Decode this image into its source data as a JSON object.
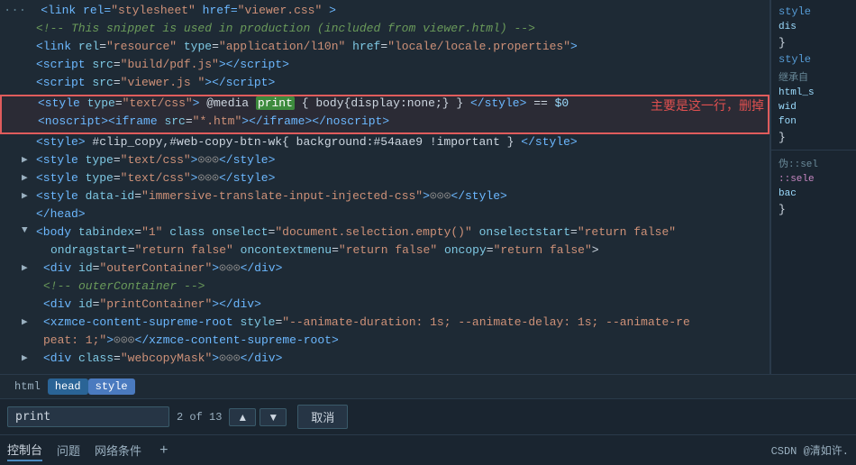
{
  "editor": {
    "lines": [
      {
        "id": "line1",
        "gutter": "",
        "expand": "",
        "content_html": "&lt;link rel=\"stylesheet\" href=\"viewer.css\" &gt;"
      },
      {
        "id": "line2",
        "gutter": "",
        "expand": "",
        "content_html": "&lt;!-- This snippet is used in production (included from viewer.html) --&gt;"
      },
      {
        "id": "line3",
        "gutter": "",
        "expand": "",
        "content_html": "&lt;link rel=\"resource\" type=\"application/l10n\" href=\"locale/locale.properties\"&gt;"
      },
      {
        "id": "line4",
        "gutter": "",
        "expand": "",
        "content_html": "&lt;script src=\"build/pdf.js\"&gt;&lt;/script&gt;"
      },
      {
        "id": "line5",
        "gutter": "",
        "expand": "",
        "content_html": "&lt;script src=\"viewer.js \"&gt;&lt;/script&gt;"
      }
    ],
    "highlighted_lines": [
      {
        "id": "hl1",
        "content_html": "&lt;style type=\"text/css\"&gt; @media <span class=\"c-green-bg\">print</span> { body{display:none;} } &lt;/style&gt; == $0"
      },
      {
        "id": "hl2",
        "content_html": "&lt;noscript&gt;&lt;iframe src=\"*.htm\"&gt;&lt;/iframe&gt;&lt;/noscript&gt;"
      }
    ],
    "after_lines": [
      {
        "id": "al1",
        "content_html": "&lt;style&gt; #clip_copy,#web-copy-btn-wk{ background:#54aae9 !important } &lt;/style&gt;"
      },
      {
        "id": "al2",
        "expand": "▶",
        "content_html": "&lt;style type=\"text/css\"&gt;<span class=\"c-gray\">⊙⊙⊙</span>&lt;/style&gt;"
      },
      {
        "id": "al3",
        "expand": "▶",
        "content_html": "&lt;style type=\"text/css\"&gt;<span class=\"c-gray\">⊙⊙⊙</span>&lt;/style&gt;"
      },
      {
        "id": "al4",
        "expand": "▶",
        "content_html": "&lt;style data-id=\"immersive-translate-input-injected-css\"&gt;<span class=\"c-gray\">⊙⊙⊙</span>&lt;/style&gt;"
      },
      {
        "id": "al5",
        "content_html": "&lt;/head&gt;"
      }
    ],
    "body_lines": [
      {
        "id": "bl1",
        "content_html": "▼ &lt;body tabindex=\"1\" class onselect=\"document.selection.empty()\" onselectstart=\"return false\""
      },
      {
        "id": "bl2",
        "content_html": "  ondragstart=\"return false\" oncontextmenu=\"return false\" oncopy=\"return false\"&gt;"
      },
      {
        "id": "bl3",
        "expand": "▶",
        "content_html": "  &lt;div id=\"outerContainer\"&gt;<span class=\"c-gray\">⊙⊙⊙</span>&lt;/div&gt;"
      },
      {
        "id": "bl4",
        "content_html": "  &lt;!-- outerContainer --&gt;"
      },
      {
        "id": "bl5",
        "content_html": "  &lt;div id=\"printContainer\"&gt;&lt;/div&gt;"
      },
      {
        "id": "bl6",
        "expand": "▶",
        "content_html": "  &lt;xzmce-content-supreme-root style=\"--animate-duration: 1s; --animate-delay: 1s; --animate-re"
      },
      {
        "id": "bl7",
        "content_html": "  peat: 1;\"&gt;<span class=\"c-gray\">⊙⊙⊙</span>&lt;/xzmce-content-supreme-root&gt;"
      },
      {
        "id": "bl8",
        "expand": "▶",
        "content_html": "  &lt;div class=\"webcopyMask\"&gt;<span class=\"c-gray\">⊙⊙⊙</span>&lt;/div&gt;"
      }
    ]
  },
  "annotation": {
    "text": "主要是这一行，删掉"
  },
  "right_panel": {
    "sections": [
      {
        "label": "style",
        "type": "keyword"
      },
      {
        "label": "dis",
        "type": "label"
      },
      {
        "label": "}",
        "type": "brace"
      },
      {
        "label": "style",
        "type": "keyword"
      },
      {
        "label": "继承自",
        "type": "muted"
      },
      {
        "label": "html_s",
        "type": "label"
      },
      {
        "label": "wid",
        "type": "label"
      },
      {
        "label": "fon",
        "type": "label"
      },
      {
        "label": "}",
        "type": "brace"
      },
      {
        "label": "伪::sel",
        "type": "muted"
      },
      {
        "label": "::sele",
        "type": "pseudo"
      },
      {
        "label": "bac",
        "type": "label"
      },
      {
        "label": "}",
        "type": "brace"
      }
    ]
  },
  "breadcrumb": {
    "items": [
      "html",
      "head",
      "style"
    ]
  },
  "search": {
    "input_value": "print",
    "count_text": "2 of 13",
    "up_label": "▲",
    "down_label": "▼",
    "cancel_label": "取消"
  },
  "tabs": {
    "items": [
      "控制台",
      "问题",
      "网络条件"
    ],
    "active": "控制台",
    "add_label": "+",
    "bottom_right": "CSDN @清如许."
  }
}
